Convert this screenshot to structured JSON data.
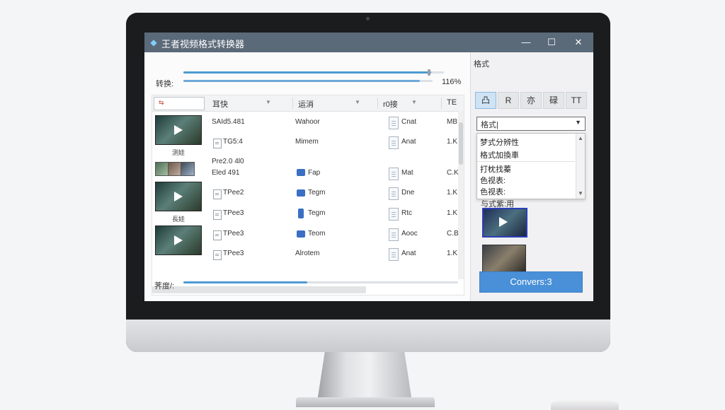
{
  "window": {
    "title": "王者视频格式转换器",
    "minimize": "—",
    "maximize": "☐",
    "close": "✕"
  },
  "progress_top": {
    "label": "转换:",
    "percent_text": "116%",
    "fill": 0.95
  },
  "table": {
    "columns": [
      "耳快",
      "运消",
      "r0接",
      "TE"
    ],
    "rows": [
      {
        "name": "SAId5.481",
        "type": "Wahoor",
        "doc": "Cnat",
        "size": "MB"
      },
      {
        "name": "TG5:4",
        "type": "Mimem",
        "doc": "Anat",
        "size": "1.K"
      },
      {
        "name": "Pre2.0 4l0",
        "name2": "Eled 491",
        "type": "Fap",
        "doc": "Mat",
        "size": "C.K"
      },
      {
        "name": "TPee2",
        "type": "Tegm",
        "doc": "Dne",
        "size": "1.K"
      },
      {
        "name": "TPee3",
        "type": "Tegm",
        "doc": "Rtc",
        "size": "1.K"
      },
      {
        "name": "TPee3",
        "type": "Teom",
        "doc": "Aooc",
        "size": "C.B"
      },
      {
        "name": "TPee3",
        "type": "Alrotem",
        "doc": "Anat",
        "size": "1.K"
      }
    ],
    "thumb_captions": [
      "测娃",
      "長娃"
    ]
  },
  "progress_bottom": {
    "label": "荠度/:",
    "fill": 0.45
  },
  "side": {
    "format_label": "格式",
    "format_buttons": [
      "凸",
      "R",
      "亦",
      "碌",
      "TT"
    ],
    "select_value": "格式|",
    "dropdown_items": [
      "梦式分辨性",
      "格式加換車",
      "打枕找蓁",
      "色视表:",
      "色视表:"
    ],
    "preview_label": "与式紫:用",
    "convert_label": "Convers:3"
  },
  "colors": {
    "titlebar": "#5b6a79",
    "accent": "#4a90d9",
    "progress": "#4d9bd1"
  }
}
